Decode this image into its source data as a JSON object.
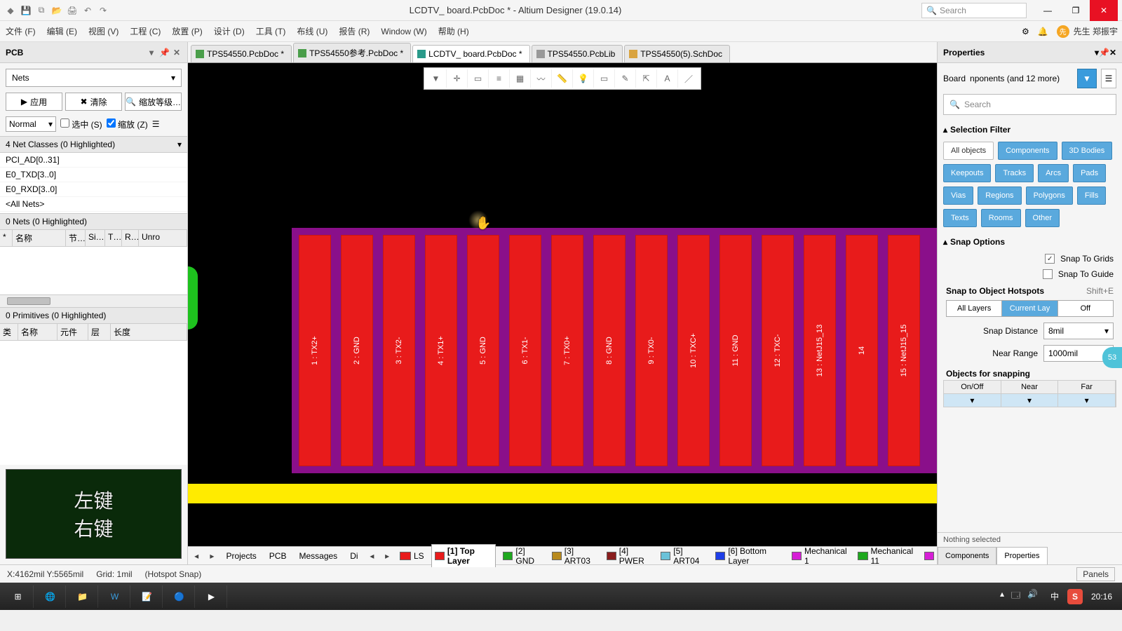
{
  "titlebar": {
    "title": "LCDTV_ board.PcbDoc * - Altium Designer (19.0.14)",
    "search_ph": "Search"
  },
  "menu": [
    "文件 (F)",
    "编辑 (E)",
    "视图 (V)",
    "工程 (C)",
    "放置 (P)",
    "设计 (D)",
    "工具 (T)",
    "布线 (U)",
    "报告 (R)",
    "Window (W)",
    "帮助 (H)"
  ],
  "user": "先生 郑振宇",
  "pcb_panel": {
    "title": "PCB",
    "combo": "Nets",
    "btn_apply": "应用",
    "btn_clear": "清除",
    "btn_zoom": "缩放等级…",
    "mode": "Normal",
    "chk_sel": "选中 (S)",
    "chk_zoom": "缩放 (Z)",
    "netclasses_h": "4 Net Classes (0 Highlighted)",
    "netclasses": [
      "PCI_AD[0..31]",
      "E0_TXD[3..0]",
      "E0_RXD[3..0]",
      "<All Nets>"
    ],
    "nets_h": "0 Nets (0 Highlighted)",
    "net_cols": [
      "*",
      "名称",
      "节…",
      "Si…",
      "T…",
      "R…",
      "Unro"
    ],
    "prims_h": "0 Primitives (0 Highlighted)",
    "prim_cols": [
      "类",
      "名称",
      "元件",
      "层",
      "长度"
    ],
    "thumb_top": "左键",
    "thumb_bot": "右键"
  },
  "doctabs": [
    {
      "label": "TPS54550.PcbDoc *",
      "cls": "green"
    },
    {
      "label": "TPS54550参考.PcbDoc *",
      "cls": "green"
    },
    {
      "label": "LCDTV_ board.PcbDoc *",
      "cls": "teal",
      "active": true
    },
    {
      "label": "TPS54550.PcbLib",
      "cls": "grey"
    },
    {
      "label": "TPS54550(5).SchDoc",
      "cls": "yell"
    }
  ],
  "pads": [
    "1 : TX2+",
    "2 : GND",
    "3 : TX2-",
    "4 : TX1+",
    "5 : GND",
    "6 : TX1-",
    "7 : TX0+",
    "8 : GND",
    "9 : TX0-",
    "10 : TXC+",
    "11 : GND",
    "12 : TXC-",
    "13 : NetJ15_13",
    "14",
    "15 : NetJ15_15"
  ],
  "layer_side_tabs": [
    "Projects",
    "PCB",
    "Messages",
    "Di"
  ],
  "layers": [
    {
      "label": "LS",
      "color": "#e81b1b",
      "bold": false
    },
    {
      "label": "[1] Top Layer",
      "color": "#e81b1b",
      "bold": true
    },
    {
      "label": "[2] GND",
      "color": "#1ea81e"
    },
    {
      "label": "[3] ART03",
      "color": "#b88a1e"
    },
    {
      "label": "[4] PWER",
      "color": "#8a1e1e"
    },
    {
      "label": "[5] ART04",
      "color": "#6ac2d9"
    },
    {
      "label": "[6] Bottom Layer",
      "color": "#1e3ee8"
    },
    {
      "label": "Mechanical 1",
      "color": "#d61ed6"
    },
    {
      "label": "Mechanical 11",
      "color": "#1ea81e"
    }
  ],
  "props": {
    "title": "Properties",
    "board": "Board",
    "npon": "nponents (and 12 more)",
    "search_ph": "Search",
    "sec_filter": "Selection Filter",
    "chip_all": "All objects",
    "chips": [
      "Components",
      "3D Bodies",
      "Keepouts",
      "Tracks",
      "Arcs",
      "Pads",
      "Vias",
      "Regions",
      "Polygons",
      "Fills",
      "Texts",
      "Rooms",
      "Other"
    ],
    "sec_snap": "Snap Options",
    "snap_grids": "Snap To Grids",
    "snap_guide": "Snap To Guide",
    "hot_h": "Snap to Object Hotspots",
    "hot_hint": "Shift+E",
    "seg": [
      "All Layers",
      "Current Lay",
      "Off"
    ],
    "dist_l": "Snap Distance",
    "dist_v": "8mil",
    "near_l": "Near Range",
    "near_v": "1000mil",
    "obj_h": "Objects for snapping",
    "obj_cols": [
      "On/Off",
      "Near",
      "Far"
    ],
    "foot_nothing": "Nothing selected",
    "foot_tabs": [
      "Components",
      "Properties"
    ]
  },
  "status": {
    "coord": "X:4162mil Y:5565mil",
    "grid": "Grid: 1mil",
    "hot": "(Hotspot Snap)",
    "panels": "Panels"
  },
  "badge": "53",
  "taskbar": {
    "time": "20:16",
    "ime": "中"
  }
}
